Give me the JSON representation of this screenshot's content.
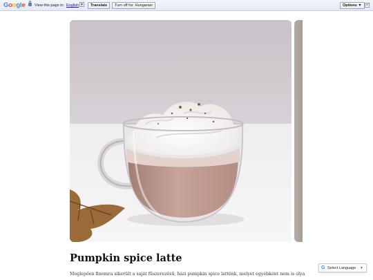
{
  "translate_bar": {
    "logo_text": "Google",
    "view_label": "View this page in:",
    "language": "English",
    "lang_dropdown_glyph": "▼",
    "translate_label": "Translate",
    "turn_off_label": "Turn off for: Hungarian",
    "options_label": "Options ▼",
    "close_glyph": "×",
    "lock_icon": "lock-icon"
  },
  "carousel": {
    "main_image_icon": "pumpkin-spice-latte-photo",
    "next_image_icon": "next-slide-photo"
  },
  "post": {
    "title": "Pumpkin spice latte",
    "excerpt": "Meglepően finomra sikerült a saját fűszerezésű, házi pumpkin spice latténk, melyet egyébként nem is olyan"
  },
  "language_widget": {
    "label": "Select Language",
    "arrow_glyph": "▼",
    "icon": "google-g-icon"
  },
  "colors": {
    "bar_bg": "#e4e9f4",
    "link": "#1a0dab",
    "title": "#111111"
  }
}
